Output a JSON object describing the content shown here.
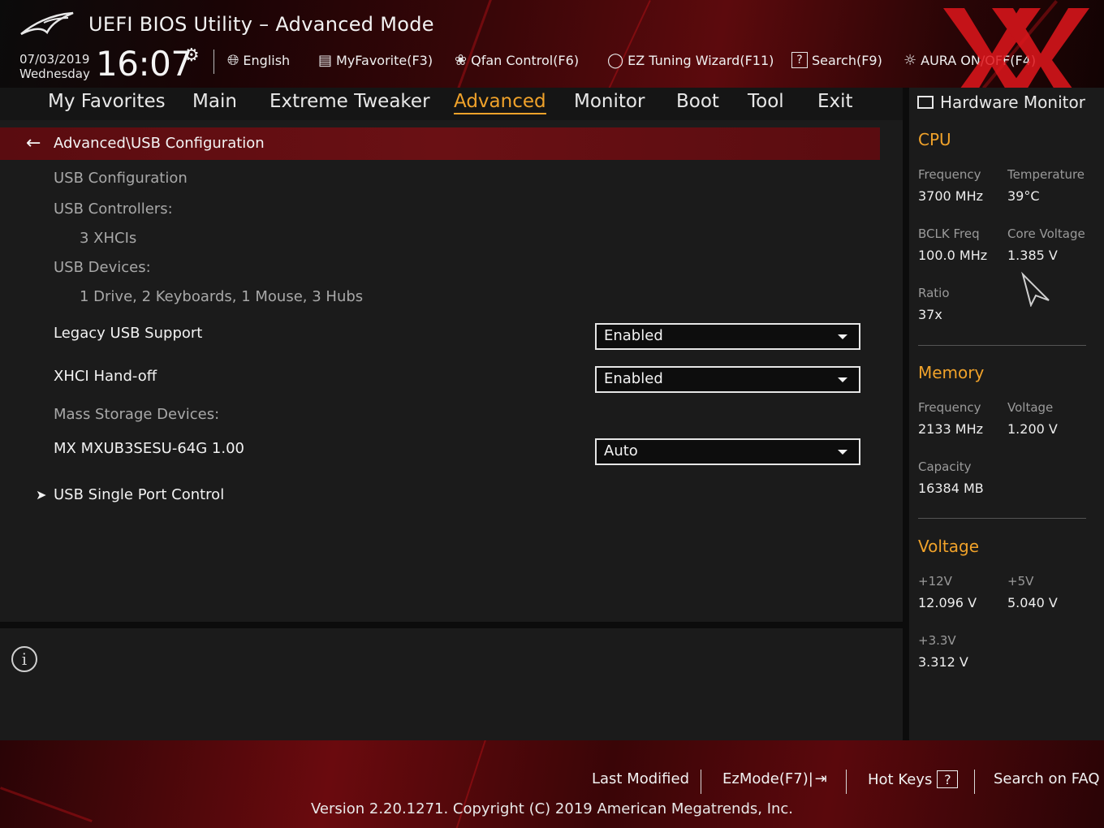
{
  "header": {
    "title": "UEFI BIOS Utility – Advanced Mode",
    "date": "07/03/2019",
    "weekday": "Wednesday",
    "time": "16:07",
    "items": {
      "language": "English",
      "myfavorite": "MyFavorite(F3)",
      "qfan": "Qfan Control(F6)",
      "ez_tuning": "EZ Tuning Wizard(F11)",
      "search": "Search(F9)",
      "aura": "AURA ON/OFF(F4)"
    }
  },
  "nav": {
    "tabs": [
      "My Favorites",
      "Main",
      "Extreme Tweaker",
      "Advanced",
      "Monitor",
      "Boot",
      "Tool",
      "Exit"
    ],
    "active": "Advanced"
  },
  "main": {
    "breadcrumb": "Advanced\\USB Configuration",
    "usb_configuration": "USB Configuration",
    "usb_controllers_label": "USB Controllers:",
    "usb_controllers_value": "3 XHCIs",
    "usb_devices_label": "USB Devices:",
    "usb_devices_value": "1 Drive, 2 Keyboards, 1 Mouse, 3 Hubs",
    "legacy_usb_label": "Legacy USB Support",
    "legacy_usb_value": "Enabled",
    "xhci_label": "XHCI Hand-off",
    "xhci_value": "Enabled",
    "mass_storage_label": "Mass Storage Devices:",
    "mass_storage_device_label": "MX MXUB3SESU-64G 1.00",
    "mass_storage_device_value": "Auto",
    "usb_single_port": "USB Single Port Control"
  },
  "hardware_monitor": {
    "title": "Hardware Monitor",
    "cpu": {
      "heading": "CPU",
      "frequency_label": "Frequency",
      "frequency": "3700 MHz",
      "temperature_label": "Temperature",
      "temperature": "39°C",
      "bclk_label": "BCLK Freq",
      "bclk": "100.0 MHz",
      "core_voltage_label": "Core Voltage",
      "core_voltage": "1.385 V",
      "ratio_label": "Ratio",
      "ratio": "37x"
    },
    "memory": {
      "heading": "Memory",
      "frequency_label": "Frequency",
      "frequency": "2133 MHz",
      "voltage_label": "Voltage",
      "voltage": "1.200 V",
      "capacity_label": "Capacity",
      "capacity": "16384 MB"
    },
    "voltage": {
      "heading": "Voltage",
      "v12_label": "+12V",
      "v12": "12.096 V",
      "v5_label": "+5V",
      "v5": "5.040 V",
      "v33_label": "+3.3V",
      "v33": "3.312 V"
    }
  },
  "footer": {
    "last_modified": "Last Modified",
    "ezmode": "EzMode(F7)|",
    "hot_keys": "Hot Keys",
    "hot_keys_box": "?",
    "search_faq": "Search on FAQ",
    "version": "Version 2.20.1271. Copyright (C) 2019 American Megatrends, Inc."
  },
  "colors": {
    "accent": "#f0a22a",
    "breadcrumb_bg": "#6a1014",
    "header_red": "#5c0a0d"
  }
}
